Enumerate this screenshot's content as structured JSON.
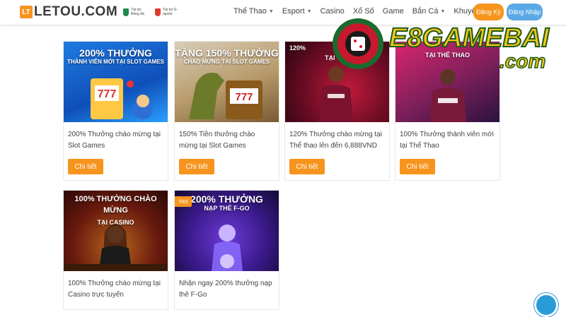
{
  "header": {
    "logo_mark": "LT",
    "logo_text": "LETOU.COM",
    "sponsors": [
      "Tài trợ Bóng đá",
      "Tài trợ E-sports"
    ],
    "nav": [
      {
        "label": "Thể Thao",
        "dropdown": true
      },
      {
        "label": "Esport",
        "dropdown": true
      },
      {
        "label": "Casino",
        "dropdown": false
      },
      {
        "label": "Xổ Số",
        "dropdown": false
      },
      {
        "label": "Game",
        "dropdown": false
      },
      {
        "label": "Bắn Cá",
        "dropdown": true
      },
      {
        "label": "Khuyến Mãi",
        "dropdown": true
      }
    ],
    "register_label": "Đăng Ký",
    "login_label": "Đăng Nhập"
  },
  "watermark": {
    "brand": "E8GAMEBAI",
    "domain": ".com"
  },
  "promotions": [
    {
      "banner_big": "200% THƯỞNG",
      "banner_small": "THÀNH VIÊN MỚI TẠI SLOT GAMES",
      "description": "200% Thưởng chào mừng tại Slot Games",
      "cta": "Chi tiết",
      "hot": false
    },
    {
      "banner_big": "TẶNG 150% THƯỞNG",
      "banner_small": "CHÀO MỪNG TẠI SLOT GAMES",
      "description": "150% Tiền thưởng chào mừng tại Slot Games",
      "cta": "Chi tiết",
      "hot": false
    },
    {
      "banner_big": "120%",
      "banner_small": "TẠI THỂ",
      "description": "120% Thưởng chào mừng tại Thể thao lên đến 6,888VND",
      "cta": "Chi tiết",
      "hot": false
    },
    {
      "banner_big": "",
      "banner_small": "TẠI THỂ THAO",
      "description": "100% Thưởng thành viên mới tại Thể Thao",
      "cta": "Chi tiết",
      "hot": false
    },
    {
      "banner_big": "100% THƯỞNG CHÀO MỪNG",
      "banner_small": "TẠI CASINO",
      "description": "100% Thưởng chào mừng tại Casino trực tuyến",
      "cta": "",
      "hot": false
    },
    {
      "banner_big": "200% THƯỞNG",
      "banner_small": "NẠP THẺ F-GO",
      "description": "Nhận ngay 200% thưởng nạp thẻ F-Go",
      "cta": "",
      "hot": true,
      "hot_label": "Hot"
    }
  ],
  "colors": {
    "accent": "#f7941d",
    "login": "#5aa9e6"
  }
}
